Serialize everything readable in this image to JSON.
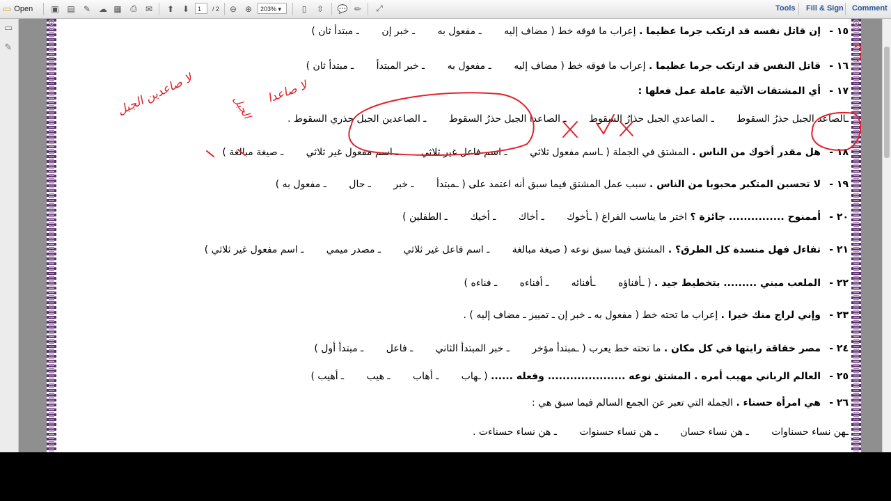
{
  "toolbar": {
    "open_label": "Open",
    "page_number": "1",
    "page_total": "/ 2",
    "zoom": "203%",
    "tools_label": "Tools",
    "fill_sign_label": "Fill & Sign",
    "comment_label": "Comment"
  },
  "questions": [
    {
      "num": "١٥ -",
      "stem": "إن قاتل نفسه قد ارتكب جرما عظيما .",
      "task": "إعراب ما فوقه خط",
      "opts": [
        "( مضاف إليه",
        "ـ مفعول به",
        "ـ خبر إن",
        "ـ مبتدأ ثان )"
      ]
    },
    {
      "num": "١٦ -",
      "stem": "قاتل النفس قد ارتكب جرما عظيما .",
      "task": "إعراب ما فوقه خط",
      "opts": [
        "( مضاف إليه",
        "ـ مفعول به",
        "ـ خبر المبتدأ",
        "ـ مبتدأ ثان )"
      ]
    },
    {
      "num": "١٧ -",
      "stem": "أي المشتقات الآتية عاملة عمل فعلها :",
      "task": "",
      "opts": []
    },
    {
      "num": "",
      "stem": "",
      "task": "",
      "opts": [
        "ـالصاعد الجبل حذرُ السقوط",
        "ـ الصاعدي الجبل حذارُ السقوط",
        "ـ الصاعدا الجبل حذرُ السقوط",
        "ـ الصاعدين الجبل حذري السقوط ."
      ]
    },
    {
      "num": "١٨ -",
      "stem": "هل مقدر أخوك من الناس .",
      "task": "المشتق في الجملة",
      "opts": [
        "( ـاسم مفعول ثلاثي",
        "ـ اسم فاعل غير ثلاثي",
        "ـ اسم مفعول غير ثلاثي",
        "ـ صيغة مبالغة )"
      ]
    },
    {
      "num": "١٩ -",
      "stem": "لا تحسبن المتكبر محبوبا من الناس .",
      "task": "سبب عمل المشتق فيما سبق أنه اعتمد على",
      "opts": [
        "( ـمبتدأ",
        "ـ خبر",
        "ـ حال",
        "ـ مفعول به )"
      ]
    },
    {
      "num": "٢٠ -",
      "stem": "أممنوح ............... جائزة ؟",
      "task": "اختر ما يناسب الفراغ",
      "opts": [
        "( ـأخوك",
        "ـ أخاك",
        "ـ أخيك",
        "ـ الطفلين )"
      ]
    },
    {
      "num": "٢١ -",
      "stem": "تفاءل فهل منسدة كل الطرق؟ .",
      "task": "المشتق فيما سبق نوعه",
      "opts": [
        "( صيغة مبالغة",
        "ـ اسم فاعل غير ثلاثي",
        "ـ مصدر ميمي",
        "ـ اسم مفعول غير ثلاثي )"
      ]
    },
    {
      "num": "٢٢ -",
      "stem": "الملعب مبني ......... بتخطيط جيد .",
      "task": "",
      "opts": [
        "( ـأفناؤه",
        "ـأفنائه",
        "ـ أفناءه",
        "ـ فناءه )"
      ]
    },
    {
      "num": "٢٣ -",
      "stem": "وإني لراج منك خيرا .",
      "task": "إعراب ما تحته خط ( مفعول به ـ خبر إن ـ تمييز ـ مضاف إليه ) .",
      "opts": []
    },
    {
      "num": "٢٤ -",
      "stem": "مصر خفاقة رايتها في كل مكان .",
      "task": "ما تحته خط يعرب",
      "opts": [
        "( ـمبتدأ مؤخر",
        "ـ خبر المبتدأ الثاني",
        "ـ فاعل",
        "ـ مبتدأ أول )"
      ]
    },
    {
      "num": "٢٥ -",
      "stem": "العالم الرباني مهيب أمره . المشتق نوعه ..................... وفعله ......",
      "task": "",
      "opts": [
        "( ـهاب",
        "ـ أهاب",
        "ـ هيب",
        "ـ أهيب )"
      ]
    },
    {
      "num": "٢٦ -",
      "stem": "هي امرأة حسناء .",
      "task": "الجملة التي تعبر عن الجمع السالم فيما سبق هي :",
      "opts": []
    },
    {
      "num": "",
      "stem": "",
      "task": "",
      "opts": [
        "ـهن نساء حسناوات",
        "ـ هن نساء حسان",
        "ـ هن نساء حسنوات",
        "ـ هن نساء حسناءت ."
      ]
    }
  ],
  "annotations": {
    "handwritten_1": "لا صاعدين الجبل",
    "handwritten_2": "الجبل",
    "handwritten_3": "لا صاعدا",
    "ink_color": "#e0202a"
  }
}
